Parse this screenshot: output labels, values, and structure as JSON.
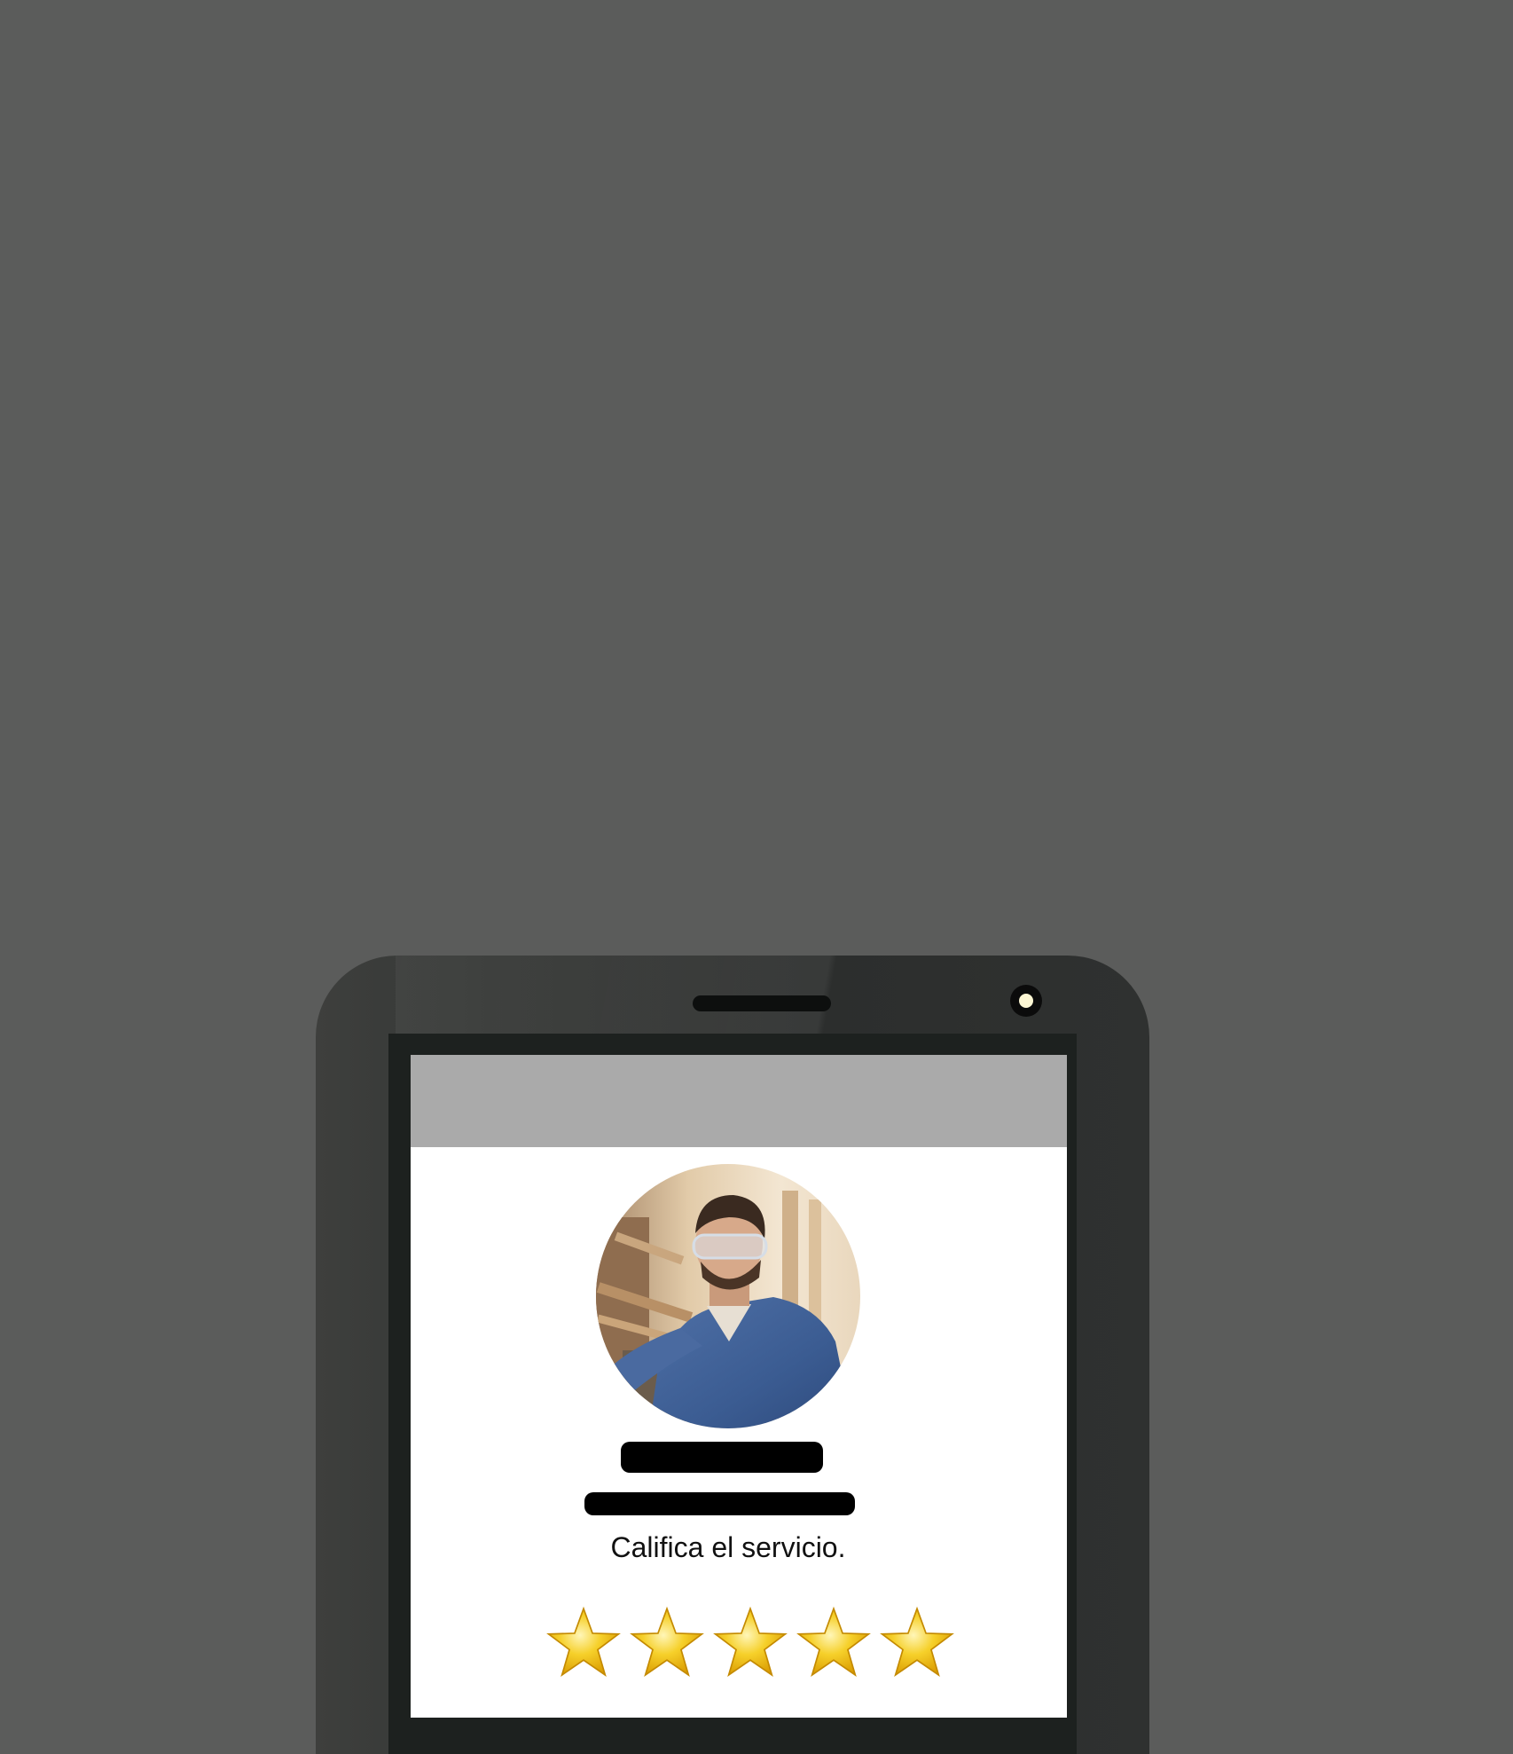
{
  "rating_screen": {
    "prompt": "Califica el servicio.",
    "rating": {
      "value": 5,
      "max": 5
    },
    "stars": [
      {
        "label": "1"
      },
      {
        "label": "2"
      },
      {
        "label": "3"
      },
      {
        "label": "4"
      },
      {
        "label": "5"
      }
    ]
  },
  "colors": {
    "background": "#5b5c5b",
    "phone_body": "#323432",
    "status_bar": "#aaaaaa",
    "star_fill": "#f4c51c",
    "redaction": "#000000"
  },
  "icons": {
    "star": "star-icon",
    "camera": "camera-icon"
  }
}
